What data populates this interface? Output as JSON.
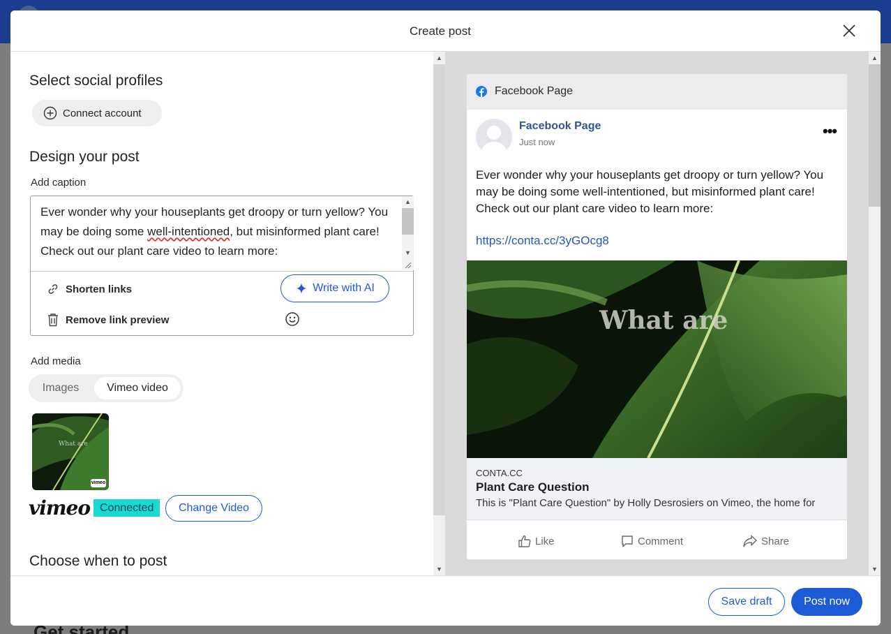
{
  "background": {
    "section_heading": "Get started"
  },
  "modal": {
    "title": "Create post"
  },
  "left": {
    "profiles_heading": "Select social profiles",
    "connect_label": "Connect account",
    "design_heading": "Design your post",
    "caption_label": "Add caption",
    "caption": {
      "before": "Ever wonder why your houseplants get droopy or turn yellow? You may be doing some ",
      "misspelled": "well-intentioned",
      "after": ", but misinformed plant care! Check out our plant care video to learn more:"
    },
    "shorten_links": "Shorten links",
    "write_ai": "Write with AI",
    "remove_preview": "Remove link preview",
    "media_label": "Add media",
    "media_tabs": {
      "images": "Images",
      "vimeo": "Vimeo video"
    },
    "thumb_overlay": "What are",
    "thumb_badge": "vimeo",
    "vimeo_logo": "vimeo",
    "connected": "Connected",
    "change_video": "Change Video",
    "when_heading": "Choose when to post"
  },
  "preview": {
    "header": "Facebook Page",
    "page_name": "Facebook Page",
    "timestamp": "Just now",
    "more": "•••",
    "post_text": "Ever wonder why your houseplants get droopy or turn yellow? You may be doing some well-intentioned, but misinformed plant care! Check out our plant care video to learn more:",
    "link": "https://conta.cc/3yGOcg8",
    "image_overlay": "What are",
    "link_domain": "CONTA.CC",
    "link_title": "Plant Care Question",
    "link_desc": "This is \"Plant Care Question\" by Holly Desrosiers on Vimeo, the home for",
    "actions": {
      "like": "Like",
      "comment": "Comment",
      "share": "Share"
    }
  },
  "footer": {
    "save_draft": "Save draft",
    "post_now": "Post now"
  },
  "colors": {
    "accent": "#1d5bd6",
    "connected_bg": "#1ad9d0",
    "facebook": "#1877f2",
    "link": "#2557b5"
  },
  "icons": [
    "close-icon",
    "plus-circle-icon",
    "link-icon",
    "sparkle-icon",
    "trash-icon",
    "smiley-icon",
    "facebook-icon",
    "like-icon",
    "comment-icon",
    "share-icon"
  ]
}
